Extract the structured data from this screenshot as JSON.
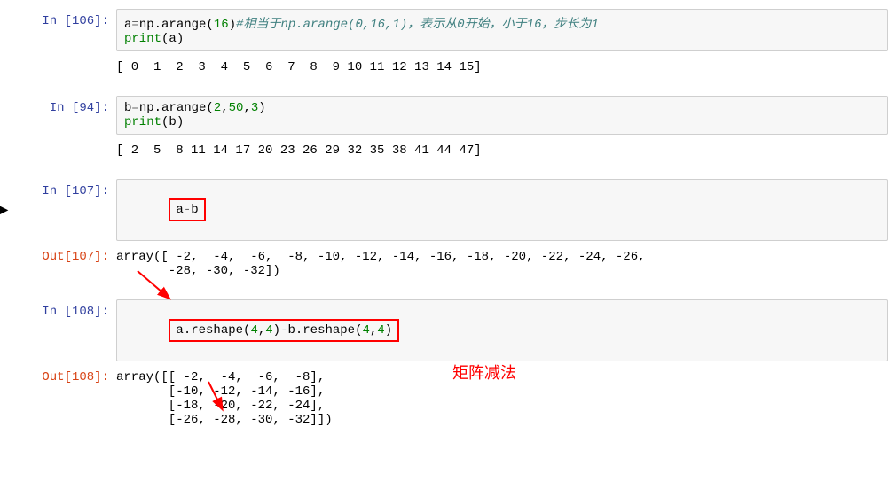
{
  "cells": {
    "c106": {
      "prompt": "In [106]:",
      "code_html": "a<span class='o'>=</span>np.arange(<span class='mi'>16</span>)<span class='c'>#相当于np.arange(0,16,1)，表示从0开始，小于16，步长为1</span>\n<span class='nb'>print</span>(a)",
      "output": "[ 0  1  2  3  4  5  6  7  8  9 10 11 12 13 14 15]"
    },
    "c94": {
      "prompt": "In [94]:",
      "code_html": "b<span class='o'>=</span>np.arange(<span class='mi'>2</span>,<span class='mi'>50</span>,<span class='mi'>3</span>)\n<span class='nb'>print</span>(b)",
      "output": "[ 2  5  8 11 14 17 20 23 26 29 32 35 38 41 44 47]"
    },
    "c107": {
      "prompt": "In [107]:",
      "code_html": "a<span class='o'>-</span>b",
      "out_prompt": "Out[107]:",
      "output": "array([ -2,  -4,  -6,  -8, -10, -12, -14, -16, -18, -20, -22, -24, -26,\n       -28, -30, -32])"
    },
    "c108": {
      "prompt": "In [108]:",
      "code_html": "a.reshape(<span class='mi'>4</span>,<span class='mi'>4</span>)<span class='o'>-</span>b.reshape(<span class='mi'>4</span>,<span class='mi'>4</span>)",
      "out_prompt": "Out[108]:",
      "output": "array([[ -2,  -4,  -6,  -8],\n       [-10, -12, -14, -16],\n       [-18, -20, -22, -24],\n       [-26, -28, -30, -32]])"
    }
  },
  "annotation": {
    "label": "矩阵减法"
  }
}
